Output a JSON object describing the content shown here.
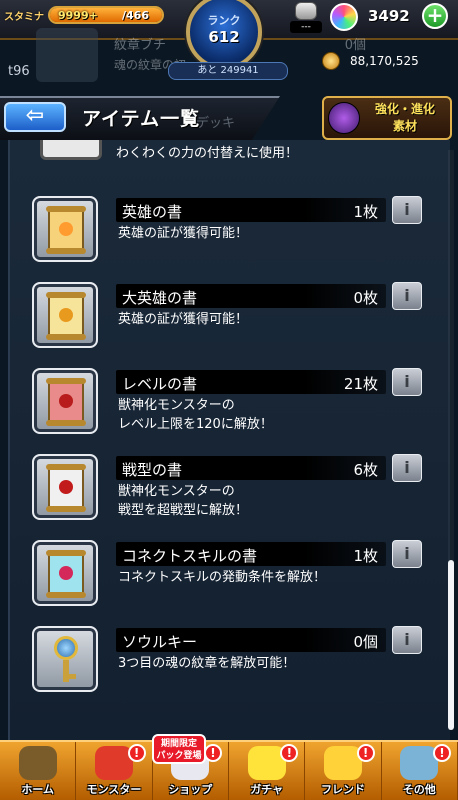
{
  "status": {
    "stamina_label": "スタミナ",
    "stamina_value": "9999+",
    "stamina_max": "/466",
    "stamina_fill": 1.0,
    "rank_label": "ランク",
    "rank_value": "612",
    "rank_next": "あと 249941",
    "item_slot_value": "---",
    "orb_count": "3492",
    "add_orb_symbol": "+",
    "gold_count": "88,170,525",
    "player_tag": "t96"
  },
  "ghost_row": {
    "name": "紋章ブチ",
    "count": "0個",
    "desc": "魂の紋章の初"
  },
  "header": {
    "back_symbol": "⇦",
    "title": "アイテム一覧",
    "underlap_text": "デッキ",
    "evolve_banner": "強化・進化\n素材"
  },
  "partial_item": {
    "desc": "わくわくの力の付替えに使用！"
  },
  "items": [
    {
      "name": "英雄の書",
      "count": "1枚",
      "desc": "英雄の証が獲得可能！",
      "emblem_color": "#ff9b2f",
      "scroll_color": "#f6d27a"
    },
    {
      "name": "大英雄の書",
      "count": "0枚",
      "desc": "英雄の証が獲得可能！",
      "emblem_color": "#e89a1f",
      "scroll_color": "#f7e49b"
    },
    {
      "name": "レベルの書",
      "count": "21枚",
      "desc": "獣神化モンスターの\nレベル上限を120に解放！",
      "emblem_color": "#b81c1c",
      "scroll_color": "#e98b8b"
    },
    {
      "name": "戦型の書",
      "count": "6枚",
      "desc": "獣神化モンスターの\n戦型を超戦型に解放！",
      "emblem_color": "#c21b1b",
      "scroll_color": "#f0f0f0"
    },
    {
      "name": "コネクトスキルの書",
      "count": "1枚",
      "desc": "コネクトスキルの発動条件を解放！",
      "emblem_color": "#d4285a",
      "scroll_color": "#9fe3ef"
    },
    {
      "name": "ソウルキー",
      "count": "0個",
      "desc": "3つ目の魂の紋章を解放可能！",
      "emblem_color": "#4fa3e0",
      "scroll_color": "#c9a03a"
    }
  ],
  "info_symbol": "i",
  "scroll_position": 0.92,
  "nav": {
    "limited_badge": "期間限定\nパック登場",
    "items": [
      {
        "label": "ホーム",
        "icon": "home-icon",
        "color": "#7a5b2a",
        "alert": ""
      },
      {
        "label": "モンスター",
        "icon": "monster-icon",
        "color": "#e03b2a",
        "alert": "!"
      },
      {
        "label": "ショップ",
        "icon": "shop-icon",
        "color": "#e8e8f0",
        "alert": "!"
      },
      {
        "label": "ガチャ",
        "icon": "gacha-icon",
        "color": "#ffe23a",
        "alert": "!"
      },
      {
        "label": "フレンド",
        "icon": "friend-icon",
        "color": "#ffd23a",
        "alert": "!"
      },
      {
        "label": "その他",
        "icon": "other-icon",
        "color": "#7ab3d6",
        "alert": "!"
      }
    ]
  }
}
